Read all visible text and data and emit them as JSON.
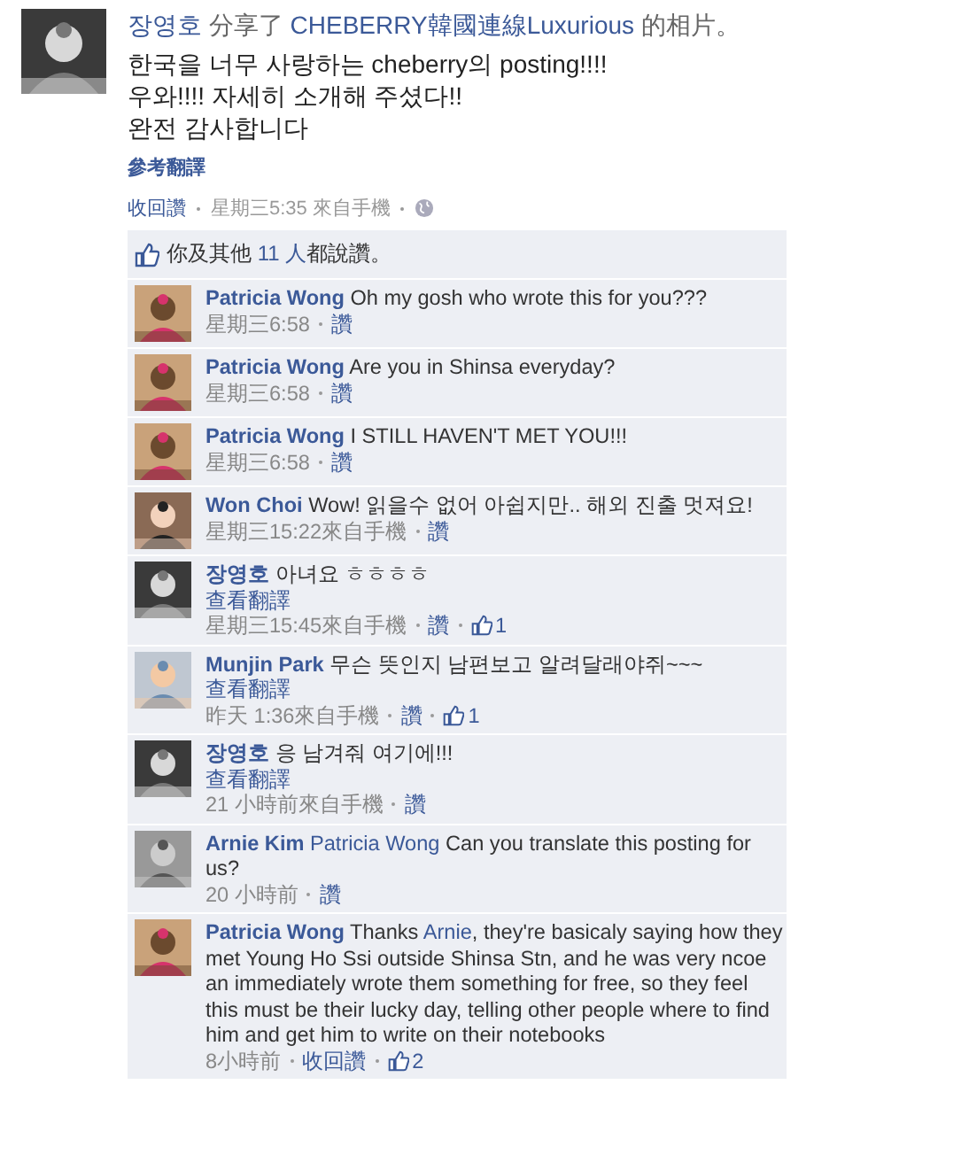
{
  "post": {
    "author": "장영호",
    "verb": "分享了",
    "page": "CHEBERRY韓國連線Luxurious",
    "object": "的相片。",
    "lines": [
      "한국을 너무 사랑하는 cheberry의 posting!!!!",
      "우와!!!! 자세히 소개해 주셨다!!",
      "완전 감사합니다"
    ],
    "translate": "參考翻譯",
    "unlike": "收回讚",
    "time": "星期三5:35 來自手機"
  },
  "likes": {
    "before": "你及其他",
    "count": "11 人",
    "after": "都說讚。"
  },
  "comments": [
    {
      "author": "Patricia Wong",
      "parts": [
        {
          "kind": "plain",
          "text": "Oh my gosh who wrote this for you???"
        }
      ],
      "time": "星期三6:58",
      "action": "讚"
    },
    {
      "author": "Patricia Wong",
      "parts": [
        {
          "kind": "plain",
          "text": "Are you in Shinsa everyday?"
        }
      ],
      "time": "星期三6:58",
      "action": "讚"
    },
    {
      "author": "Patricia Wong",
      "parts": [
        {
          "kind": "plain",
          "text": "I STILL HAVEN'T MET YOU!!!"
        }
      ],
      "time": "星期三6:58",
      "action": "讚"
    },
    {
      "author": "Won Choi",
      "parts": [
        {
          "kind": "plain",
          "text": "Wow! 읽을수 없어 아쉽지만.. 해외 진출 멋져요!"
        }
      ],
      "time": "星期三15:22來自手機",
      "action": "讚"
    },
    {
      "author": "장영호",
      "parts": [
        {
          "kind": "plain",
          "text": "아녀요 ㅎㅎㅎㅎ"
        }
      ],
      "translate": "查看翻譯",
      "time": "星期三15:45來自手機",
      "action": "讚",
      "like_count": "1"
    },
    {
      "author": "Munjin Park",
      "parts": [
        {
          "kind": "plain",
          "text": "무슨 뜻인지 남편보고 알려달래야쥐~~~"
        }
      ],
      "translate": "查看翻譯",
      "time": "昨天 1:36來自手機",
      "action": "讚",
      "like_count": "1"
    },
    {
      "author": "장영호",
      "parts": [
        {
          "kind": "plain",
          "text": "응 남겨줘 여기에!!!"
        }
      ],
      "translate": "查看翻譯",
      "time": "21 小時前來自手機",
      "action": "讚"
    },
    {
      "author": "Arnie Kim",
      "parts": [
        {
          "kind": "link",
          "text": "Patricia Wong"
        },
        {
          "kind": "plain",
          "text": " Can you translate this posting for us?"
        }
      ],
      "time": "20 小時前",
      "action": "讚"
    },
    {
      "author": "Patricia Wong",
      "parts": [
        {
          "kind": "plain",
          "text": "Thanks "
        },
        {
          "kind": "link",
          "text": "Arnie"
        },
        {
          "kind": "plain",
          "text": ", they're basicaly saying how they met Young Ho Ssi outside Shinsa Stn, and he was very ncoe an immediately wrote them something for free, so they feel this must be their lucky day, telling other people where to find him and get him to write on their notebooks"
        }
      ],
      "time": "8小時前",
      "action": "收回讚",
      "like_count": "2"
    }
  ]
}
